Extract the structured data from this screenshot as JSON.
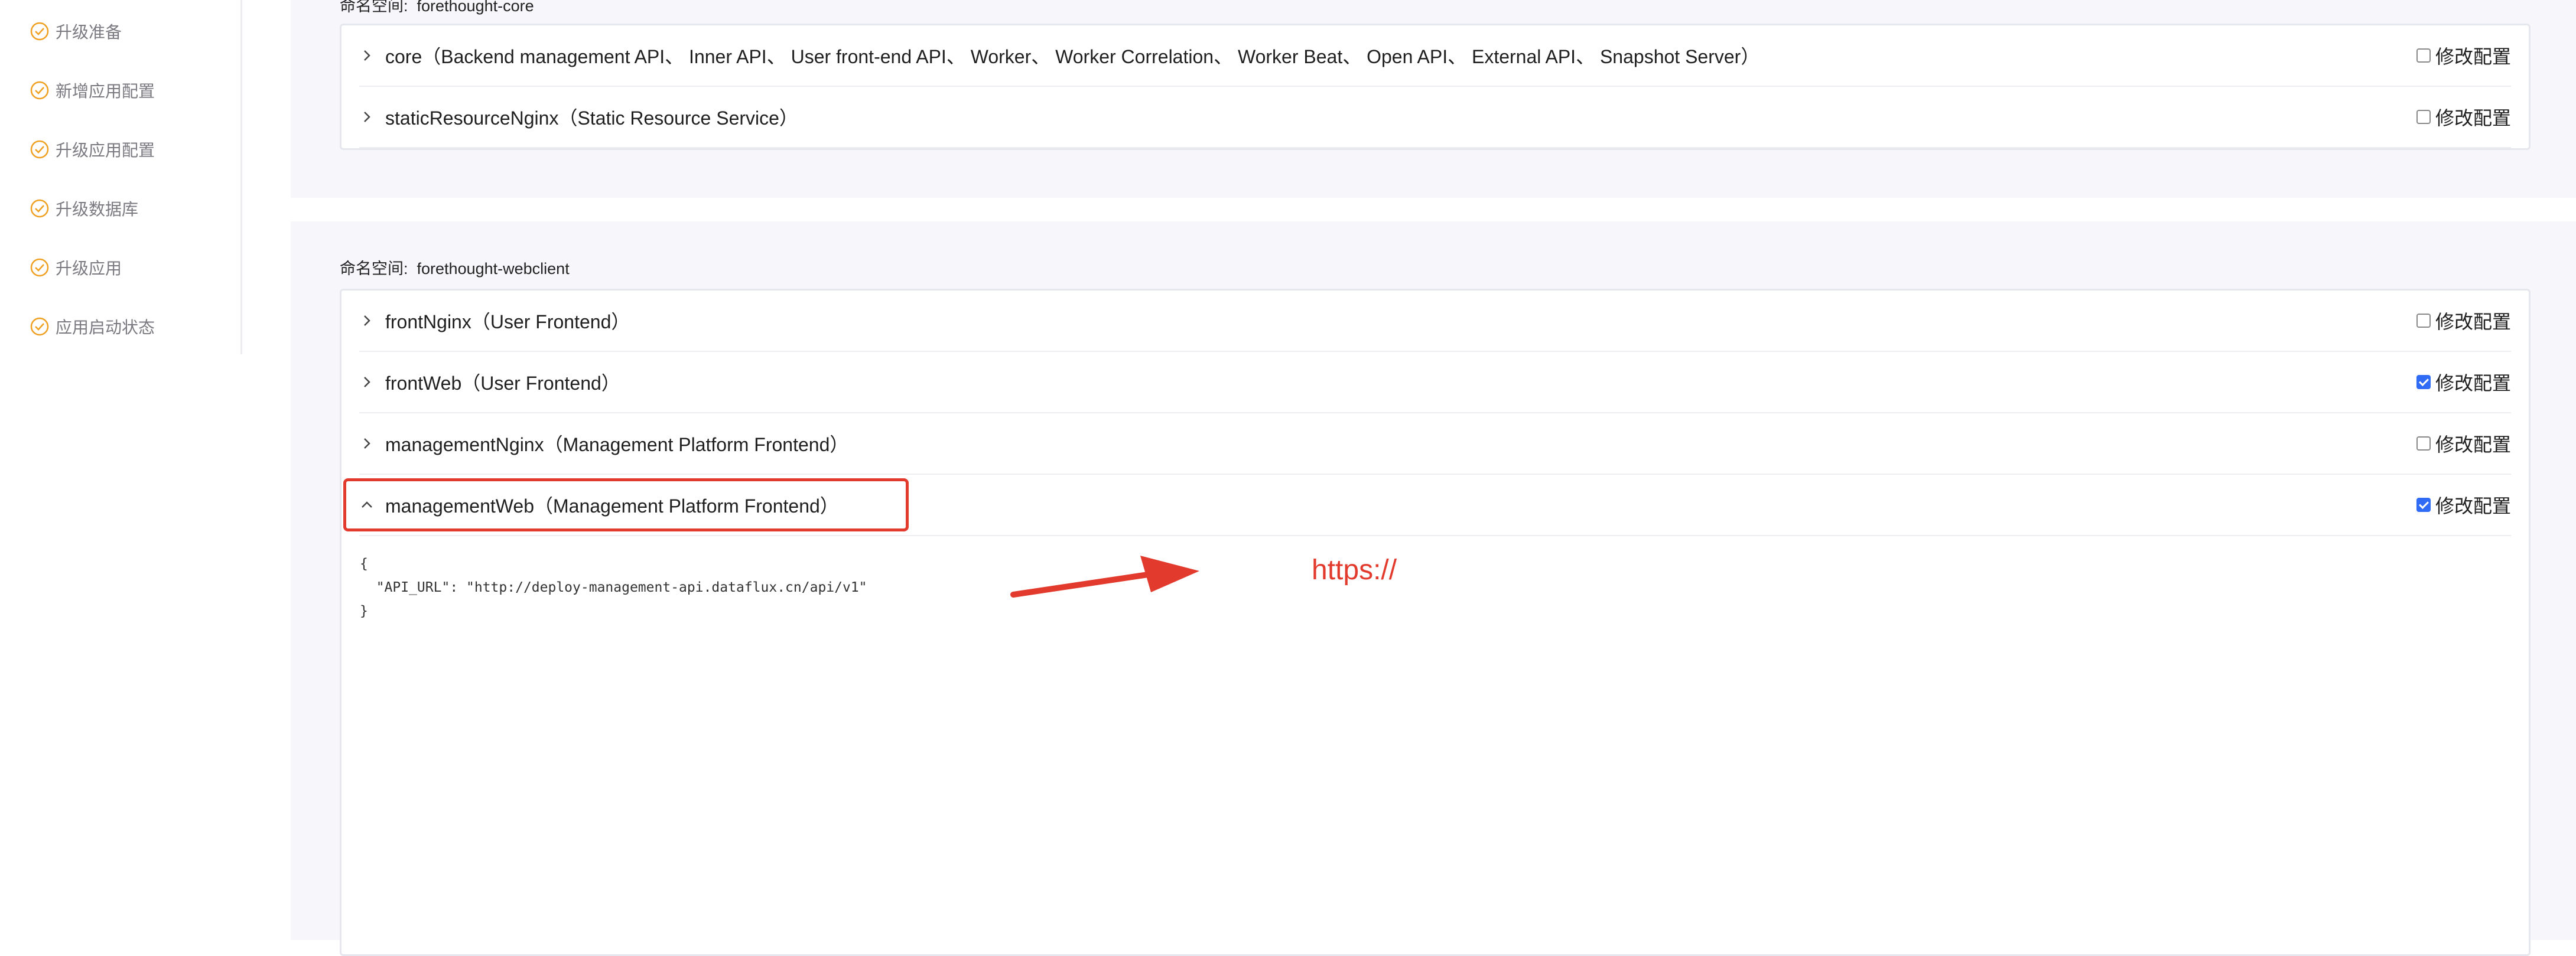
{
  "sidebar": {
    "steps": [
      {
        "label": "升级准备"
      },
      {
        "label": "新增应用配置"
      },
      {
        "label": "升级应用配置"
      },
      {
        "label": "升级数据库"
      },
      {
        "label": "升级应用"
      },
      {
        "label": "应用启动状态"
      }
    ]
  },
  "namespaces": [
    {
      "label": "命名空间:",
      "name": "forethought-core",
      "items": [
        {
          "title": "core（Backend management API、 Inner API、 User front-end API、 Worker、 Worker Correlation、 Worker Beat、 Open API、 External API、 Snapshot Server）",
          "config_label": "修改配置",
          "checked": false,
          "expanded": false
        },
        {
          "title": "staticResourceNginx（Static Resource Service）",
          "config_label": "修改配置",
          "checked": false,
          "expanded": false
        }
      ]
    },
    {
      "label": "命名空间:",
      "name": "forethought-webclient",
      "items": [
        {
          "title": "frontNginx（User Frontend）",
          "config_label": "修改配置",
          "checked": false,
          "expanded": false
        },
        {
          "title": "frontWeb（User Frontend）",
          "config_label": "修改配置",
          "checked": true,
          "expanded": false
        },
        {
          "title": "managementNginx（Management Platform Frontend）",
          "config_label": "修改配置",
          "checked": false,
          "expanded": false
        },
        {
          "title": "managementWeb（Management Platform Frontend）",
          "config_label": "修改配置",
          "checked": true,
          "expanded": true
        }
      ]
    }
  ],
  "editor": {
    "line1": "{",
    "line2": "  \"API_URL\": \"http://deploy-management-api.dataflux.cn/api/v1\"",
    "line3": "}"
  },
  "annotation": {
    "text": "https://",
    "color": "#e23b2e"
  },
  "colors": {
    "accent": "#2f6bf5",
    "success": "#f0a020",
    "highlight": "#e23b2e"
  }
}
